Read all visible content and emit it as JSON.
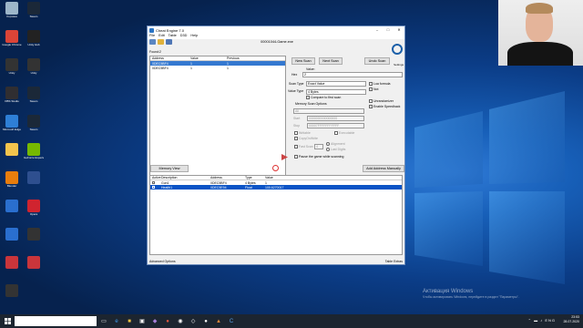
{
  "desktop": {
    "icons": [
      {
        "label": "Корзина",
        "color": "#9db6c9"
      },
      {
        "label": "Steam",
        "color": "#1b2838"
      },
      {
        "label": "Google Chrome",
        "color": "#db4437"
      },
      {
        "label": "Unity Hub",
        "color": "#222"
      },
      {
        "label": "Unity",
        "color": "#333"
      },
      {
        "label": "Unity",
        "color": "#333"
      },
      {
        "label": "OBS Studio",
        "color": "#302e31"
      },
      {
        "label": "Steam",
        "color": "#1b2838"
      },
      {
        "label": "Microsoft Edge",
        "color": "#2e7fd6"
      },
      {
        "label": "Steam",
        "color": "#1b2838"
      },
      {
        "label": "",
        "color": "#f3c44d"
      },
      {
        "label": "GeForce Experience",
        "color": "#76b900"
      },
      {
        "label": "Blender",
        "color": "#e87d0d"
      },
      {
        "label": "",
        "color": "#2e4f8f"
      },
      {
        "label": "",
        "color": "#2a6fcf"
      },
      {
        "label": "Opera",
        "color": "#d0242f"
      },
      {
        "label": "",
        "color": "#2a6fcf"
      },
      {
        "label": "",
        "color": "#333"
      },
      {
        "label": "",
        "color": "#c9353b"
      },
      {
        "label": "",
        "color": "#c9353b"
      },
      {
        "label": "",
        "color": "#333"
      }
    ]
  },
  "activation": {
    "title": "Активация Windows",
    "subtitle": "Чтобы активировать Windows, перейдите в раздел \"Параметры\"."
  },
  "cheat_engine": {
    "title": "Cheat Engine 7.0",
    "window_buttons": [
      "–",
      "□",
      "✕"
    ],
    "menu": [
      "File",
      "Edit",
      "Table",
      "D3D",
      "Help"
    ],
    "process": "00001044-Game.exe",
    "found": "Found:2",
    "results": {
      "columns": [
        "Address",
        "Value",
        "Previous"
      ],
      "rows": [
        {
          "address": "0DEC5BF4",
          "value": "1",
          "previous": "1"
        },
        {
          "address": "0DEC5BF4",
          "value": "1",
          "previous": "1"
        }
      ]
    },
    "buttons": {
      "new_scan": "New Scan",
      "next_scan": "Next Scan",
      "undo_scan": "Undo Scan",
      "memory_view": "Memory View",
      "add_address": "Add Address Manually"
    },
    "settings_label": "Settings",
    "value_label": "Value:",
    "hex_label": "Hex",
    "value_input": "2",
    "scan_type_label": "Scan Type",
    "scan_type": "Exact Value",
    "value_type_label": "Value Type",
    "value_type": "4 Bytes",
    "compare_first": "Compare to first scan",
    "lua_formula": "Lua formula",
    "not_label": "Not",
    "unrandomizer": "Unrandomizer",
    "enable_speedhack": "Enable Speedhack",
    "memory_scan_options": "Memory Scan Options",
    "region": "All",
    "start_label": "Start",
    "start_value": "0000000000000000",
    "stop_label": "Stop",
    "stop_value": "00007FFFFFFFFFFF",
    "writable": "Writable",
    "executable": "Executable",
    "copy_on_write": "CopyOnWrite",
    "fast_scan": "Fast Scan",
    "fast_scan_value": "4",
    "alignment": "Alignment",
    "last_digits": "Last Digits",
    "pause_game": "Pause the game while scanning",
    "addresses": {
      "columns": [
        "Active",
        "Description",
        "Address",
        "Type",
        "Value"
      ],
      "rows": [
        {
          "description": "Gun1",
          "address": "0DEC5BF4",
          "type": "4 Bytes",
          "value": "1"
        },
        {
          "description": "Health1",
          "address": "0DEC5E94",
          "type": "Float",
          "value": "100.6270017"
        }
      ]
    },
    "status_left": "Advanced Options",
    "status_right": "Table Extras"
  },
  "taskbar": {
    "search": "",
    "time": "23:53",
    "date": "28.07.2020"
  }
}
